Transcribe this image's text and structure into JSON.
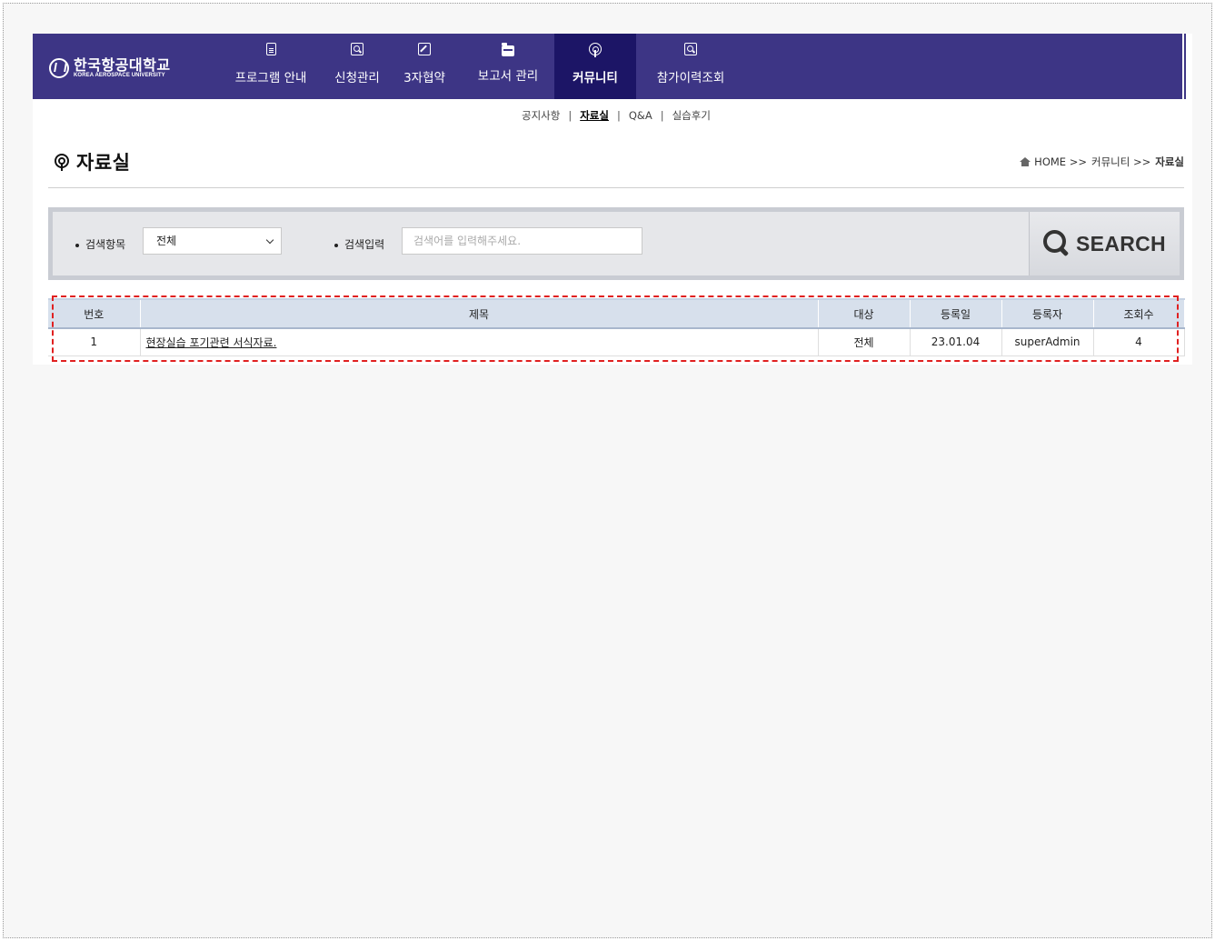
{
  "header": {
    "logo_kr": "한국항공대학교",
    "logo_en": "KOREA AEROSPACE UNIVERSITY",
    "menu": [
      {
        "label": "프로그램 안내",
        "icon": "document-icon"
      },
      {
        "label": "신청관리",
        "icon": "search-icon"
      },
      {
        "label": "3자협약",
        "icon": "edit-icon"
      },
      {
        "label": "보고서 관리",
        "icon": "folder-icon"
      },
      {
        "label": "커뮤니티",
        "icon": "podcast-icon",
        "active": true
      },
      {
        "label": "참가이력조회",
        "icon": "search-icon"
      }
    ],
    "colors": {
      "nav_bg": "#3d3585",
      "nav_active": "#1c1566"
    }
  },
  "subnav": {
    "items": [
      "공지사항",
      "자료실",
      "Q&A",
      "실습후기"
    ],
    "current": "자료실",
    "separator": "|"
  },
  "page": {
    "title": "자료실",
    "title_icon": "podcast-icon",
    "breadcrumb": {
      "home": "HOME >>",
      "mid": "커뮤니티 >>",
      "last": "자료실"
    }
  },
  "search": {
    "category_label": "검색항목",
    "category_value": "전체",
    "input_label": "검색입력",
    "input_placeholder": "검색어를 입력해주세요.",
    "button_label": "SEARCH"
  },
  "table": {
    "headers": [
      "번호",
      "제목",
      "대상",
      "등록일",
      "등록자",
      "조회수"
    ],
    "rows": [
      {
        "no": "1",
        "title": "현장실습 포기관련 서식자료.",
        "target": "전체",
        "date": "23.01.04",
        "author": "superAdmin",
        "views": "4"
      }
    ]
  }
}
